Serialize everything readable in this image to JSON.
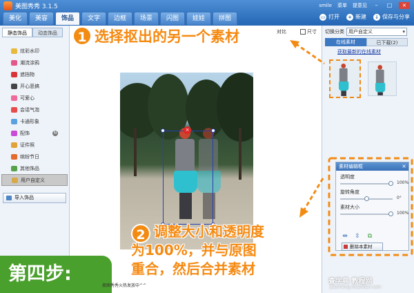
{
  "app": {
    "title": "美图秀秀 3.1.5"
  },
  "user": {
    "name": "smile",
    "menu": "菜单",
    "feedback": "提意见"
  },
  "top_tabs": [
    "美化",
    "美容",
    "饰品",
    "文字",
    "边框",
    "场景",
    "闪图",
    "娃娃",
    "拼图"
  ],
  "active_tab_index": 2,
  "toolbar": {
    "open": "打开",
    "new": "新建",
    "save_share": "保存与分享"
  },
  "left_panel": {
    "tabs": [
      "静态饰品",
      "动态饰品"
    ],
    "categories": [
      {
        "label": "炫彩水印",
        "icon": "watermark-icon",
        "color": "#e8b93f"
      },
      {
        "label": "潮流涂鸦",
        "icon": "lips-icon",
        "color": "#e2588a"
      },
      {
        "label": "遮挡物",
        "icon": "stop-icon",
        "color": "#d9343a"
      },
      {
        "label": "开心恶搞",
        "icon": "beard-icon",
        "color": "#444444"
      },
      {
        "label": "可爱心",
        "icon": "heart-icon",
        "color": "#f06b9b"
      },
      {
        "label": "会话气泡",
        "icon": "speech-bubble-icon",
        "color": "#e84b4b"
      },
      {
        "label": "卡通形象",
        "icon": "cartoon-icon",
        "color": "#5ba1e0"
      },
      {
        "label": "配饰",
        "icon": "bow-icon",
        "color": "#c94bd6",
        "badge": "N"
      },
      {
        "label": "证件照",
        "icon": "id-photo-icon",
        "color": "#e0a239"
      },
      {
        "label": "缤纷节日",
        "icon": "gift-icon",
        "color": "#e56a2e"
      },
      {
        "label": "其他饰品",
        "icon": "misc-icon",
        "color": "#56a24a"
      },
      {
        "label": "用户自定义",
        "icon": "folder-icon",
        "color": "#d8a94a"
      }
    ],
    "selected_index": 11,
    "import_button": "导入饰品"
  },
  "canvas_tools": {
    "compare": "对比",
    "size": "尺寸"
  },
  "right_panel": {
    "category_label": "切换分类",
    "category_value": "用户自定义",
    "tabs": [
      "在线素材",
      "已下载(2)"
    ],
    "online_link": "获取最新的在线素材",
    "material_editor": {
      "title": "素材编辑框",
      "opacity_label": "透明度",
      "opacity_value": "100%",
      "opacity_fraction": 1.0,
      "rotate_label": "旋转角度",
      "rotate_value": "0°",
      "rotate_fraction": 0.5,
      "size_label": "素材大小",
      "size_value": "100%",
      "size_fraction": 1.0,
      "delete_button": "删除本素材"
    }
  },
  "annotations": {
    "step1_number": "1",
    "step1_text": "选择抠出的另一个素材",
    "step2_number": "2",
    "step2_lines": [
      "调整大小和透明度",
      "为100%，并与原图",
      "重合，然后合并素材"
    ],
    "step_label": "第四步:"
  },
  "status": {
    "text": "美图秀秀火热发放中^^"
  },
  "watermark": {
    "main": "查字典 教程网",
    "sub": "jiaocheng.chazidian.com"
  },
  "colors": {
    "accent": "#f58a12",
    "step_green": "#4aa02c",
    "selection": "#2840b0",
    "title_blue": "#2466b4"
  }
}
